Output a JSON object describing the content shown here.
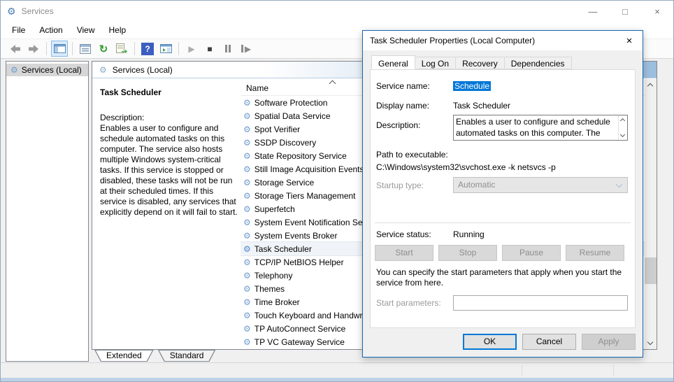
{
  "window": {
    "title": "Services",
    "controls": {
      "minimize": "—",
      "maximize": "□",
      "close": "×"
    }
  },
  "menu": {
    "items": [
      "File",
      "Action",
      "View",
      "Help"
    ]
  },
  "toolbar": {
    "icons": [
      "back",
      "forward",
      "show-console-tree",
      "properties",
      "refresh",
      "export-list",
      "help",
      "show-action-pane",
      "start-service",
      "stop-service",
      "pause-service",
      "restart-service"
    ]
  },
  "tree": {
    "root": "Services (Local)"
  },
  "services_panel": {
    "header": "Services (Local)",
    "selected_service_title": "Task Scheduler",
    "description_label": "Description:",
    "description": "Enables a user to configure and schedule automated tasks on this computer. The service also hosts multiple Windows system-critical tasks. If this service is stopped or disabled, these tasks will not be run at their scheduled times. If this service is disabled, any services that explicitly depend on it will fail to start.",
    "column_header": "Name",
    "selected_service": "Task Scheduler",
    "services": [
      "Software Protection",
      "Spatial Data Service",
      "Spot Verifier",
      "SSDP Discovery",
      "State Repository Service",
      "Still Image Acquisition Events",
      "Storage Service",
      "Storage Tiers Management",
      "Superfetch",
      "System Event Notification Service",
      "System Events Broker",
      "Task Scheduler",
      "TCP/IP NetBIOS Helper",
      "Telephony",
      "Themes",
      "Time Broker",
      "Touch Keyboard and Handwriting Panel",
      "TP AutoConnect Service",
      "TP VC Gateway Service"
    ],
    "view_tabs": [
      "Extended",
      "Standard"
    ],
    "active_view_tab": "Extended"
  },
  "dialog": {
    "title": "Task Scheduler Properties (Local Computer)",
    "close": "×",
    "tabs": [
      "General",
      "Log On",
      "Recovery",
      "Dependencies"
    ],
    "active_tab": "General",
    "fields": {
      "service_name_label": "Service name:",
      "service_name_value": "Schedule",
      "display_name_label": "Display name:",
      "display_name_value": "Task Scheduler",
      "description_label": "Description:",
      "description_value": "Enables a user to configure and schedule automated tasks on this computer. The service also",
      "path_label": "Path to executable:",
      "path_value": "C:\\Windows\\system32\\svchost.exe -k netsvcs -p",
      "startup_type_label": "Startup type:",
      "startup_type_value": "Automatic",
      "service_status_label": "Service status:",
      "service_status_value": "Running",
      "start_params_help": "You can specify the start parameters that apply when you start the service from here.",
      "start_params_label": "Start parameters:",
      "start_params_value": ""
    },
    "service_buttons": [
      "Start",
      "Stop",
      "Pause",
      "Resume"
    ],
    "footer_buttons": {
      "ok": "OK",
      "cancel": "Cancel",
      "apply": "Apply"
    }
  },
  "colors": {
    "accent": "#0078d7",
    "dialog_border": "#1567b3",
    "selection_bg": "#0078d7",
    "header_gradient_end": "#9cbede",
    "disabled_text": "#8d8d8d"
  }
}
